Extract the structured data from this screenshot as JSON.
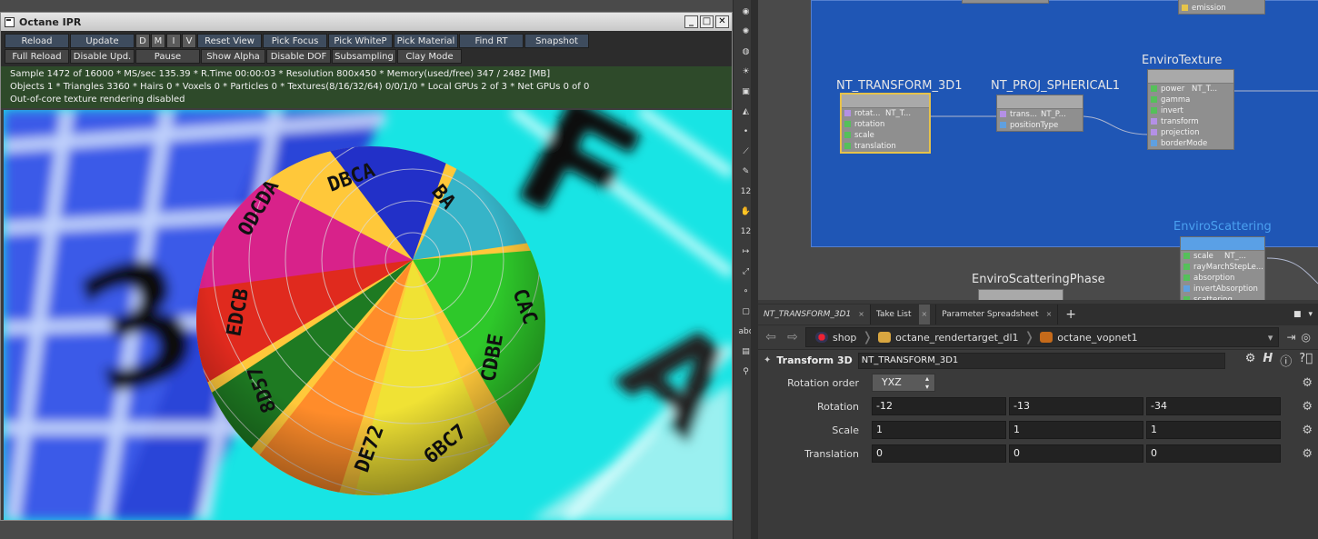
{
  "ipr": {
    "title": "Octane IPR",
    "buttons_row1": [
      "Reload",
      "Update",
      "D",
      "M",
      "I",
      "V",
      "Reset View",
      "Pick Focus",
      "Pick WhiteP",
      "Pick Material",
      "Find RT",
      "Snapshot"
    ],
    "buttons_row2": [
      "Full Reload",
      "Disable Upd.",
      "Pause",
      "Show Alpha",
      "Disable DOF",
      "Subsampling",
      "Clay Mode"
    ],
    "stats": [
      "Sample 1472 of 16000 * MS/sec 135.39 * R.Time 00:00:03 * Resolution 800x450 * Memory(used/free) 347 / 2482 [MB]",
      "Objects 1 * Triangles 3360 * Hairs 0 * Voxels 0 * Particles 0 * Textures(8/16/32/64) 0/0/1/0 * Local GPUs 2 of 3 * Net GPUs 0 of 0",
      "Out-of-core texture rendering disabled"
    ],
    "window_buttons": {
      "minimize": "_",
      "maximize": "□",
      "close": "✕"
    }
  },
  "shelf": {
    "labels": [
      "12",
      "12",
      "abc"
    ]
  },
  "network": {
    "nodes": {
      "transform": {
        "title": "NT_TRANSFORM_3D1",
        "rows": [
          {
            "label": "rotat...",
            "out": "NT_T..."
          },
          {
            "label": "rotation"
          },
          {
            "label": "scale"
          },
          {
            "label": "translation"
          }
        ]
      },
      "proj": {
        "title": "NT_PROJ_SPHERICAL1",
        "rows": [
          {
            "label": "trans...",
            "out": "NT_P..."
          },
          {
            "label": "positionType"
          }
        ]
      },
      "enviro": {
        "title": "EnviroTexture",
        "rows": [
          {
            "label": "power",
            "out": "NT_T..."
          },
          {
            "label": "gamma"
          },
          {
            "label": "invert"
          },
          {
            "label": "transform"
          },
          {
            "label": "projection"
          },
          {
            "label": "borderMode"
          }
        ]
      },
      "scattering": {
        "title": "EnviroScattering",
        "rows": [
          {
            "label": "scale",
            "out": "NT_..."
          },
          {
            "label": "rayMarchStepLe..."
          },
          {
            "label": "absorption"
          },
          {
            "label": "invertAbsorption"
          },
          {
            "label": "scattering"
          }
        ]
      },
      "phase": {
        "title": "EnviroScatteringPhase"
      },
      "top_partial": {
        "row": "emission"
      }
    }
  },
  "params": {
    "tabs": [
      {
        "label": "NT_TRANSFORM_3D1",
        "close": "×"
      },
      {
        "label": "Take List",
        "close": "×"
      },
      {
        "label": "Parameter Spreadsheet",
        "close": "×"
      }
    ],
    "add_tab": "+",
    "path": [
      "shop",
      "octane_rendertarget_dl1",
      "octane_vopnet1"
    ],
    "node_type": "Transform 3D",
    "node_name": "NT_TRANSFORM_3D1",
    "rotation_order_label": "Rotation order",
    "rotation_order_value": "YXZ",
    "rotation_label": "Rotation",
    "rotation": [
      "-12",
      "-13",
      "-34"
    ],
    "scale_label": "Scale",
    "scale": [
      "1",
      "1",
      "1"
    ],
    "translation_label": "Translation",
    "translation": [
      "0",
      "0",
      "0"
    ]
  },
  "colors": {
    "ipr_button": "#3e4c5e",
    "stats_bg": "#2e4a2a",
    "network_bg": "#1f56b5",
    "selected_node": "#e6c24a"
  }
}
